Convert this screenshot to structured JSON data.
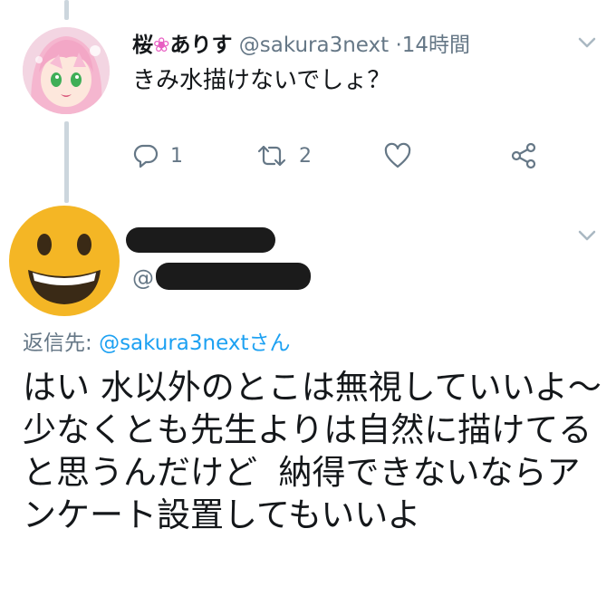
{
  "tweet1": {
    "name": "桜",
    "name_emoji": "❀",
    "name_rest": "ありす",
    "handle": "@sakura3next",
    "separator": "·",
    "time": "14時間",
    "text": "きみ水描けないでしょ？",
    "reply_count": "1",
    "retweet_count": "2"
  },
  "tweet2": {
    "handle_prefix": "@",
    "reply_to_label": "返信先:",
    "reply_to_mention": "@sakura3nextさん",
    "text": "はい 水以外のとこは無視していいよ～ 少なくとも先生よりは自然に描けてると思うんだけど  納得できないならアンケート設置してもいいよ"
  },
  "icons": [
    "reply-icon",
    "retweet-icon",
    "like-icon",
    "share-icon",
    "chevron-down-icon",
    "grinning-face-emoji"
  ],
  "colors": {
    "secondary_text": "#657786",
    "link": "#1da1f2",
    "thread_line": "#ccd6dd",
    "emoji_yellow": "#f4b625"
  }
}
